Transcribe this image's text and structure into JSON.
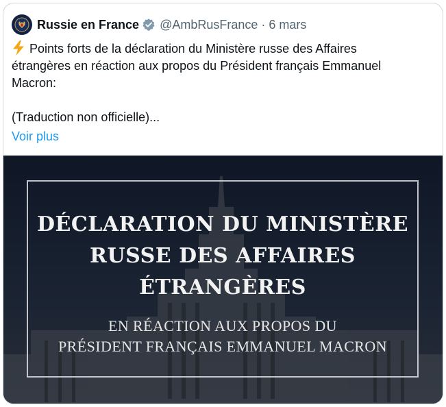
{
  "tweet": {
    "author_name": "Russie en France",
    "handle": "@AmbRusFrance",
    "separator": "·",
    "date": "6 mars",
    "text_line_1": "Points forts de la déclaration du Ministère russe des Affaires",
    "text_line_2": "étrangères en réaction aux propos du Président français Emmanuel",
    "text_line_3": "Macron:",
    "text_line_4": "(Traduction non officielle)...",
    "show_more": "Voir plus"
  },
  "media": {
    "headline_1": "DÉCLARATION DU MINISTÈRE",
    "headline_2": "RUSSE DES AFFAIRES",
    "headline_3": "ÉTRANGÈRES",
    "subline_1": "EN RÉACTION AUX PROPOS DU",
    "subline_2": "PRÉSIDENT FRANÇAIS EMMANUEL MACRON"
  },
  "icons": {
    "avatar": "russian-emblem-icon",
    "verified": "verified-badge-icon",
    "emoji": "high-voltage-icon"
  },
  "colors": {
    "link": "#1d9bf0",
    "verified_badge": "#829aab",
    "text": "#0f1419",
    "muted": "#536471"
  }
}
